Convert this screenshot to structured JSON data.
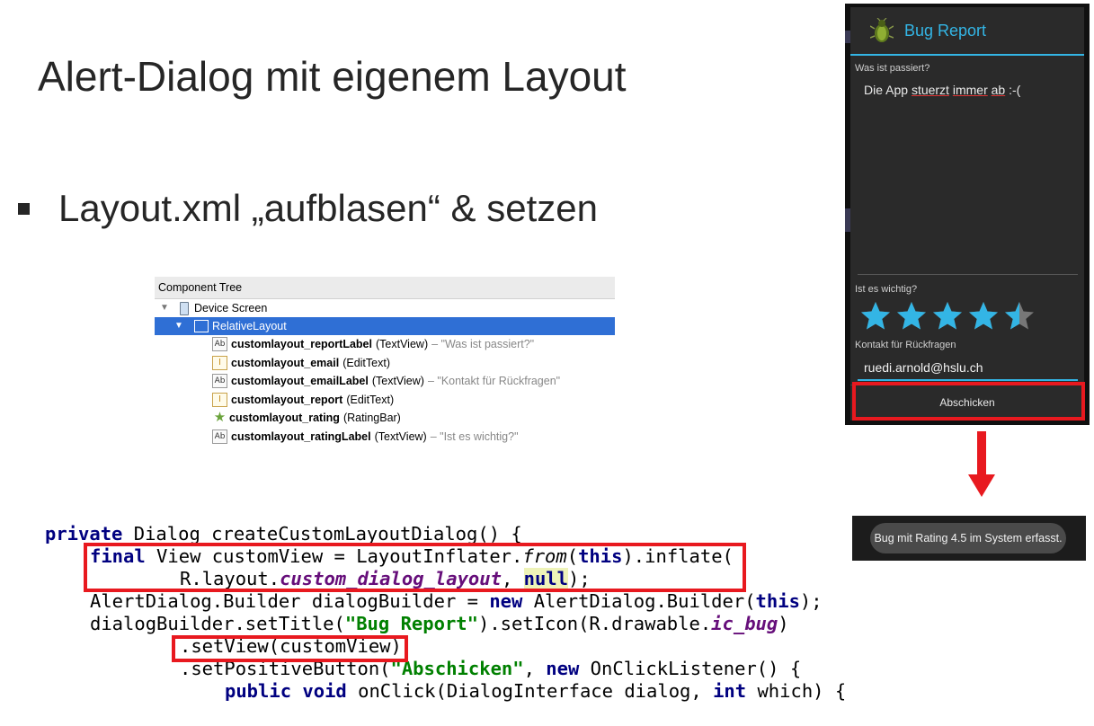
{
  "slide": {
    "title": "Alert-Dialog mit eigenem Layout",
    "bullet": "Layout.xml „aufblasen“ & setzen"
  },
  "component_tree": {
    "header": "Component Tree",
    "device": "Device Screen",
    "root": "RelativeLayout",
    "items": [
      {
        "icon": "textview-icon",
        "name": "customlayout_reportLabel",
        "type": "(TextView)",
        "hint": "– \"Was ist passiert?\""
      },
      {
        "icon": "edittext-icon",
        "name": "customlayout_email",
        "type": "(EditText)",
        "hint": ""
      },
      {
        "icon": "textview-icon",
        "name": "customlayout_emailLabel",
        "type": "(TextView)",
        "hint": "– \"Kontakt für Rückfragen\""
      },
      {
        "icon": "edittext-icon",
        "name": "customlayout_report",
        "type": "(EditText)",
        "hint": ""
      },
      {
        "icon": "ratingbar-icon",
        "name": "customlayout_rating",
        "type": "(RatingBar)",
        "hint": ""
      },
      {
        "icon": "textview-icon",
        "name": "customlayout_ratingLabel",
        "type": "(TextView)",
        "hint": "– \"Ist es wichtig?\""
      }
    ]
  },
  "code": {
    "l1_kw": "private",
    "l1_rest": " Dialog createCustomLayoutDialog() {",
    "l2_kw": "final",
    "l2_a": " View customView = LayoutInflater.",
    "l2_from": "from",
    "l2_b": "(",
    "l2_this": "this",
    "l2_c": ").inflate(",
    "l3_a": "R.layout.",
    "l3_field": "custom_dialog_layout",
    "l3_b": ", ",
    "l3_null": "null",
    "l3_c": ");",
    "l4_a": "AlertDialog.Builder dialogBuilder = ",
    "l4_new": "new",
    "l4_b": " AlertDialog.Builder(",
    "l4_this": "this",
    "l4_c": ");",
    "l5_a": "dialogBuilder.setTitle(",
    "l5_str": "\"Bug Report\"",
    "l5_b": ").setIcon(R.drawable.",
    "l5_field": "ic_bug",
    "l5_c": ")",
    "l6": ".setView(customView)",
    "l7_a": ".setPositiveButton(",
    "l7_str": "\"Abschicken\"",
    "l7_b": ", ",
    "l7_new": "new",
    "l7_c": " OnClickListener() {",
    "l8_public": "public",
    "l8_void": "void",
    "l8_a": " onClick(DialogInterface dialog, ",
    "l8_int": "int",
    "l8_b": " which) {"
  },
  "dialog": {
    "title": "Bug Report",
    "icon": "bug-icon",
    "report_label": "Was ist passiert?",
    "report_words": [
      "Die App ",
      "stuerzt",
      " ",
      "immer",
      " ",
      "ab",
      " :-("
    ],
    "rating_label": "Ist es wichtig?",
    "rating": 4.5,
    "rating_max": 5,
    "contact_label": "Kontakt für Rückfragen",
    "email": "ruedi.arnold@hslu.ch",
    "button": "Abschicken"
  },
  "toast": {
    "text": "Bug mit Rating 4.5 im System erfasst."
  },
  "colors": {
    "accent": "#33b5e5",
    "highlight_red": "#e8191f"
  }
}
